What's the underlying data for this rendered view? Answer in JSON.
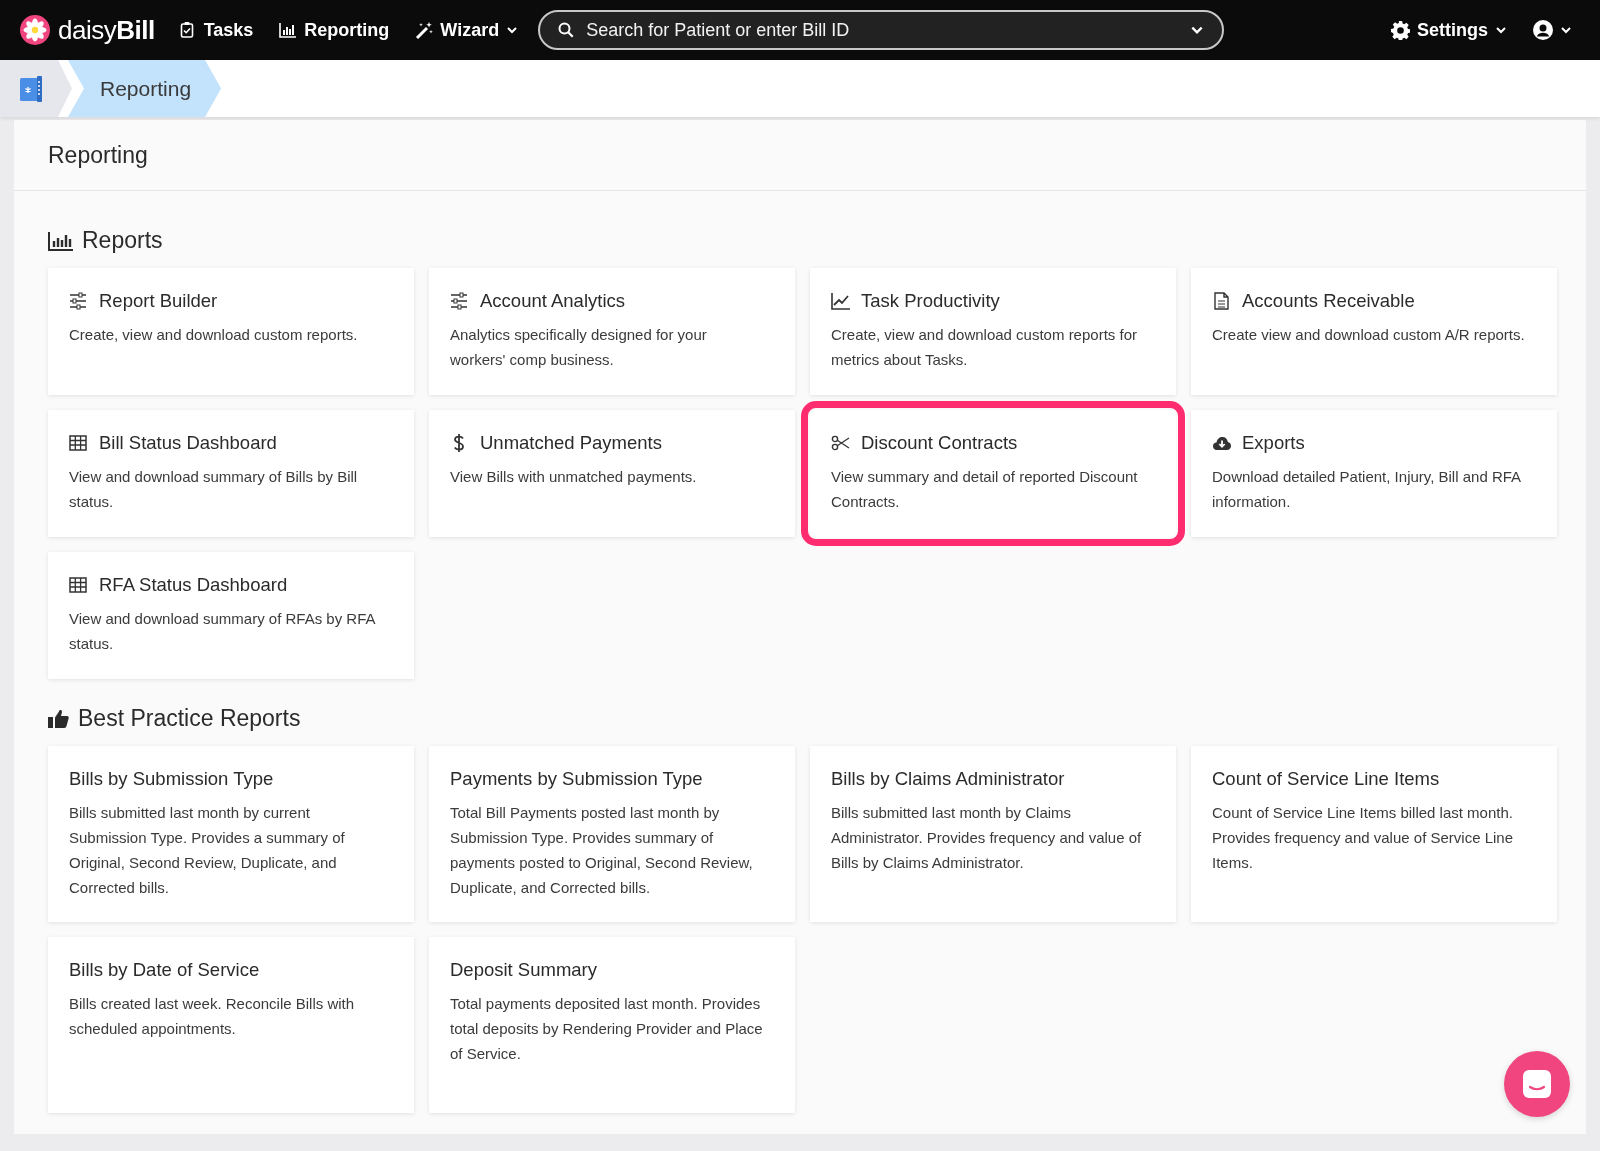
{
  "navbar": {
    "logo": {
      "brand_light": "daisy",
      "brand_bold": "Bill"
    },
    "items": [
      {
        "label": "Tasks",
        "dropdown": false
      },
      {
        "label": "Reporting",
        "dropdown": false
      },
      {
        "label": "Wizard",
        "dropdown": true
      }
    ],
    "search": {
      "placeholder": "Search for Patient or enter Bill ID"
    },
    "settings": {
      "label": "Settings"
    }
  },
  "breadcrumb": [
    {
      "label": "Reporting",
      "selected": true
    }
  ],
  "page": {
    "title": "Reporting",
    "sections": [
      {
        "title": "Reports",
        "cards": [
          {
            "title": "Report Builder",
            "description": "Create, view and download custom reports.",
            "highlighted": false
          },
          {
            "title": "Account Analytics",
            "description": "Analytics specifically designed for your workers' comp business.",
            "highlighted": false
          },
          {
            "title": "Task Productivity",
            "description": "Create, view and download custom reports for metrics about Tasks.",
            "highlighted": false
          },
          {
            "title": "Accounts Receivable",
            "description": "Create view and download custom A/R reports.",
            "highlighted": false
          },
          {
            "title": "Bill Status Dashboard",
            "description": "View and download summary of Bills by Bill status.",
            "highlighted": false
          },
          {
            "title": "Unmatched Payments",
            "description": "View Bills with unmatched payments.",
            "highlighted": false
          },
          {
            "title": "Discount Contracts",
            "description": "View summary and detail of reported Discount Contracts.",
            "highlighted": true
          },
          {
            "title": "Exports",
            "description": "Download detailed Patient, Injury, Bill and RFA information.",
            "highlighted": false
          },
          {
            "title": "RFA Status Dashboard",
            "description": "View and download summary of RFAs by RFA status.",
            "highlighted": false
          }
        ]
      },
      {
        "title": "Best Practice Reports",
        "cards": [
          {
            "title": "Bills by Submission Type",
            "description": "Bills submitted last month by current Submission Type. Provides a summary of Original, Second Review, Duplicate, and Corrected bills.",
            "highlighted": false
          },
          {
            "title": "Payments by Submission Type",
            "description": "Total Bill Payments posted last month by Submission Type. Provides summary of payments posted to Original, Second Review, Duplicate, and Corrected bills.",
            "highlighted": false
          },
          {
            "title": "Bills by Claims Administrator",
            "description": "Bills submitted last month by Claims Administrator. Provides frequency and value of Bills by Claims Administrator.",
            "highlighted": false
          },
          {
            "title": "Count of Service Line Items",
            "description": "Count of Service Line Items billed last month. Provides frequency and value of Service Line Items.",
            "highlighted": false
          },
          {
            "title": "Bills by Date of Service",
            "description": "Bills created last week. Reconcile Bills with scheduled appointments.",
            "highlighted": false
          },
          {
            "title": "Deposit Summary",
            "description": "Total payments deposited last month. Provides total deposits by Rendering Provider and Place of Service.",
            "highlighted": false
          }
        ]
      }
    ]
  }
}
